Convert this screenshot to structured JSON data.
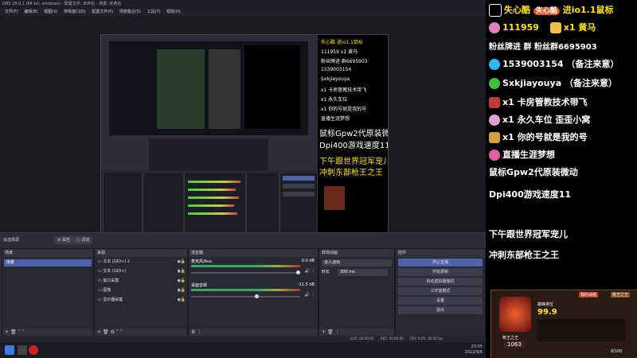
{
  "window": {
    "title": "OBS 28.0.1 (64-bit, windows) - 配置文件: 未命名 - 场景: 未命名"
  },
  "menu": [
    "文件(F)",
    "编辑(E)",
    "视图(V)",
    "停靠窗口(D)",
    "配置文件(P)",
    "场景集合(S)",
    "工具(T)",
    "帮助(H)"
  ],
  "controls_bar": {
    "status": "未选择源",
    "properties": "属性",
    "filters": "滤镜"
  },
  "docks": {
    "scenes": {
      "title": "场景",
      "items": [
        "场景"
      ]
    },
    "sources": {
      "title": "来源",
      "items": [
        "文本 (GDI+) 2",
        "文本 (GDI+)",
        "窗口采集",
        "图像",
        "显示器采集"
      ]
    },
    "mixer": {
      "title": "混音器",
      "channels": [
        {
          "name": "麦克风/Aux",
          "db": "0.0 dB"
        },
        {
          "name": "桌面音频",
          "db": "-11.5 dB"
        }
      ]
    },
    "transitions": {
      "title": "转场动画",
      "type": "淡入淡出",
      "duration_label": "时长",
      "duration": "300 ms"
    },
    "controls": {
      "title": "控件",
      "buttons": [
        "停止直播",
        "开始录制",
        "启动虚拟摄像机",
        "工作室模式",
        "设置",
        "退出"
      ]
    }
  },
  "status_bar": {
    "live": "LIVE: 00:00:00",
    "rec": "REC: 00:00:00",
    "cpu": "CPU: 0.0%, 60.00 fps"
  },
  "taskbar": {
    "time": "23:55",
    "date": "2022/9/6"
  },
  "sidebar": {
    "line1": {
      "left": "失心酷",
      "badge": "失心酷",
      "right": "进io1.1鼠标"
    },
    "line2": {
      "count": "111959",
      "gift": "x1 黄马"
    },
    "line3": "粉丝牌进 群   粉丝群6695903",
    "line4": "1539003154 （备注来意）",
    "line5": "Sxkjiayouya （备注来意）",
    "line6": "x1 卡房管教技术带飞",
    "line7": "x1 永久车位 歪歪小窝",
    "line8": "x1 你的号就是我的号",
    "line9": "直播生涯梦想",
    "big1": "鼠标Gpw2代原装微动",
    "big2": "Dpi400游戏速度11",
    "promo1": "下午跟世界冠军宠儿",
    "promo2": "冲刺东部枪王之王",
    "card": {
      "tab1": "我的战绩",
      "tab2": "枪王之王",
      "rank_label": "巅峰排位",
      "percent": "99.9",
      "score": "1063",
      "name": "枪王之王",
      "progress": "0/100"
    }
  }
}
